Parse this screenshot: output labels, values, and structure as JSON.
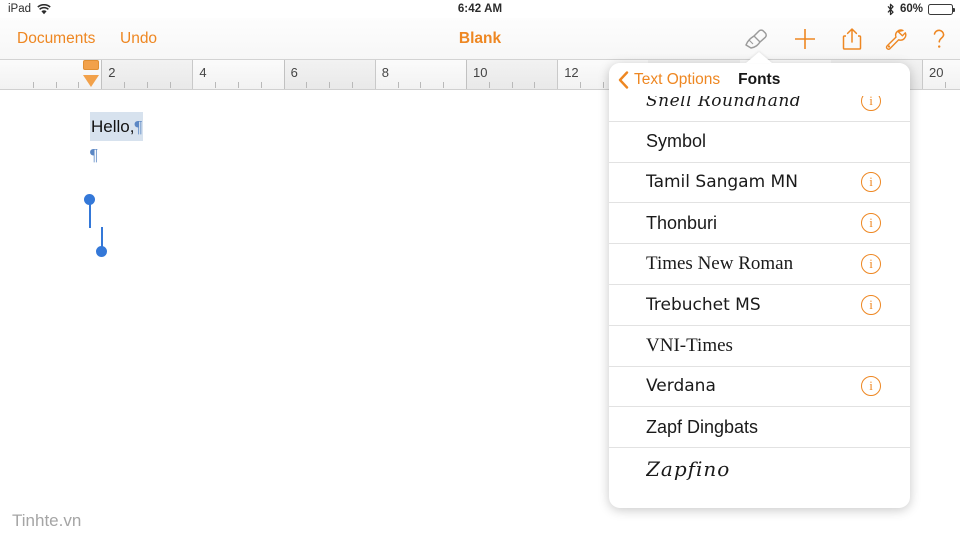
{
  "status_bar": {
    "device": "iPad",
    "wifi_icon": "wifi-icon",
    "time": "6:42 AM",
    "bluetooth_icon": "bluetooth-icon",
    "battery_percent": "60%",
    "battery_level": 60
  },
  "toolbar": {
    "documents_label": "Documents",
    "undo_label": "Undo",
    "document_title": "Blank",
    "icons": [
      {
        "name": "format-brush-icon",
        "active": true
      },
      {
        "name": "add-icon",
        "active": false
      },
      {
        "name": "share-icon",
        "active": false
      },
      {
        "name": "tools-wrench-icon",
        "active": false
      },
      {
        "name": "help-question-icon",
        "active": false
      }
    ],
    "accent_color": "#ee8722",
    "active_icon_color": "#9b9b9b"
  },
  "ruler": {
    "numbers": [
      "2",
      "4",
      "6",
      "8",
      "10",
      "12",
      "20"
    ],
    "first_line_indent_marker": "first-line-indent-marker",
    "left_indent_marker": "left-indent-marker",
    "marker_color": "#f2a14a"
  },
  "document": {
    "line1_text": "Hello,",
    "line1_pilcrow": "¶",
    "line2_pilcrow": "¶",
    "selection_color": "#d7e2ee",
    "handle_color": "#3478d8"
  },
  "watermark": "Tinhte.vn",
  "popover": {
    "back_label": "Text Options",
    "back_icon": "chevron-left-icon",
    "title": "Fonts",
    "fonts": [
      {
        "name": "Snell Roundhand",
        "info": true,
        "face": "f-script",
        "clipped": true
      },
      {
        "name": "Symbol",
        "info": false,
        "face": "f-sans",
        "clipped": false
      },
      {
        "name": "Tamil Sangam MN",
        "info": true,
        "face": "f-dejavu",
        "clipped": false
      },
      {
        "name": "Thonburi",
        "info": true,
        "face": "f-sans",
        "clipped": false
      },
      {
        "name": "Times New Roman",
        "info": true,
        "face": "f-serif",
        "clipped": false
      },
      {
        "name": "Trebuchet MS",
        "info": true,
        "face": "f-dejavu",
        "clipped": false
      },
      {
        "name": "VNI-Times",
        "info": false,
        "face": "f-serif",
        "clipped": false
      },
      {
        "name": "Verdana",
        "info": true,
        "face": "f-dejavu",
        "clipped": false
      },
      {
        "name": "Zapf Dingbats",
        "info": false,
        "face": "f-sans",
        "clipped": false
      },
      {
        "name": "Zapfino",
        "info": false,
        "face": "f-zapfino",
        "clipped": false
      }
    ]
  }
}
